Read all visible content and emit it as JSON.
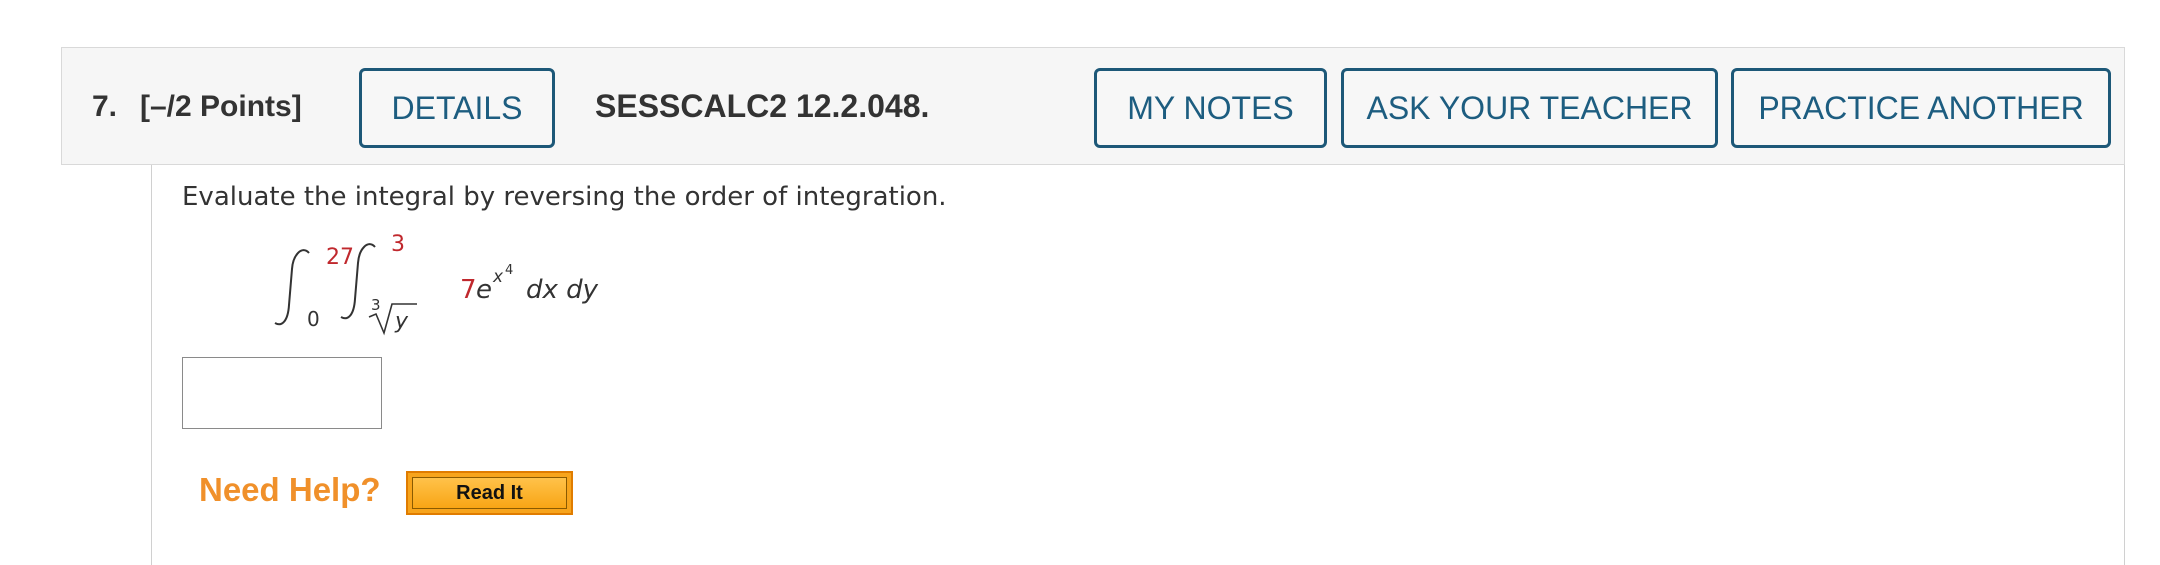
{
  "question": {
    "number": "7.",
    "points": "[–/2 Points]",
    "code": "SESSCALC2 12.2.048."
  },
  "buttons": {
    "details": "DETAILS",
    "my_notes": "MY NOTES",
    "ask_teacher": "ASK YOUR TEACHER",
    "practice_another": "PRACTICE ANOTHER"
  },
  "problem": {
    "instruction": "Evaluate the integral by reversing the order of integration.",
    "integral": {
      "outer_lower": "0",
      "outer_upper": "27",
      "inner_lower_index": "3",
      "inner_lower_radicand": "y",
      "inner_upper": "3",
      "coefficient": "7",
      "base": "e",
      "exp_var": "x",
      "exp_power": "4",
      "differentials": "dx dy"
    }
  },
  "answer": {
    "value": "",
    "placeholder": ""
  },
  "help": {
    "label": "Need Help?",
    "read_it": "Read It"
  },
  "colors": {
    "button_border": "#1d5878",
    "button_text": "#1d5d80",
    "red_value": "#c0282d",
    "help_orange": "#f0902a",
    "readit_bg": "#f7a41c"
  }
}
